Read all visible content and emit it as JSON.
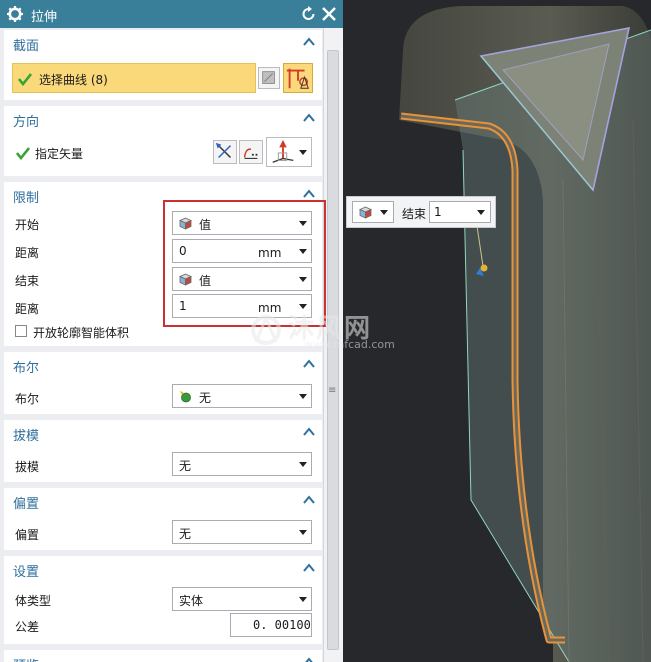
{
  "dialog": {
    "title": "拉伸",
    "icons": {
      "settings": "gear-icon",
      "reset": "reset-icon",
      "close": "close-icon"
    }
  },
  "sections": {
    "section": {
      "header": "截面",
      "curve_label": "选择曲线 (8)"
    },
    "direction": {
      "header": "方向",
      "vector_label": "指定矢量"
    },
    "limits": {
      "header": "限制",
      "start_label": "开始",
      "start_value": "值",
      "start_distance_label": "距离",
      "start_distance_value": "0",
      "start_distance_unit": "mm",
      "end_label": "结束",
      "end_value": "值",
      "end_distance_label": "距离",
      "end_distance_value": "1",
      "end_distance_unit": "mm",
      "open_profile_label": "开放轮廓智能体积"
    },
    "boolean": {
      "header": "布尔",
      "label": "布尔",
      "value": "无"
    },
    "draft": {
      "header": "拔模",
      "label": "拔模",
      "value": "无"
    },
    "offset": {
      "header": "偏置",
      "label": "偏置",
      "value": "无"
    },
    "settings": {
      "header": "设置",
      "body_type_label": "体类型",
      "body_type_value": "实体",
      "tolerance_label": "公差",
      "tolerance_value": "0. 00100"
    },
    "preview": {
      "header": "预览"
    }
  },
  "viewport": {
    "float_label": "结束",
    "float_value": "1"
  },
  "watermark": {
    "title": "沐风网",
    "url": "www.mfcad.com"
  },
  "colors": {
    "title_bar": "#3a7f9a",
    "section_header": "#2f6f9d",
    "highlight": "#fad97a",
    "check": "#35a535",
    "red_frame": "#c83232",
    "curve": "#e8923a"
  }
}
